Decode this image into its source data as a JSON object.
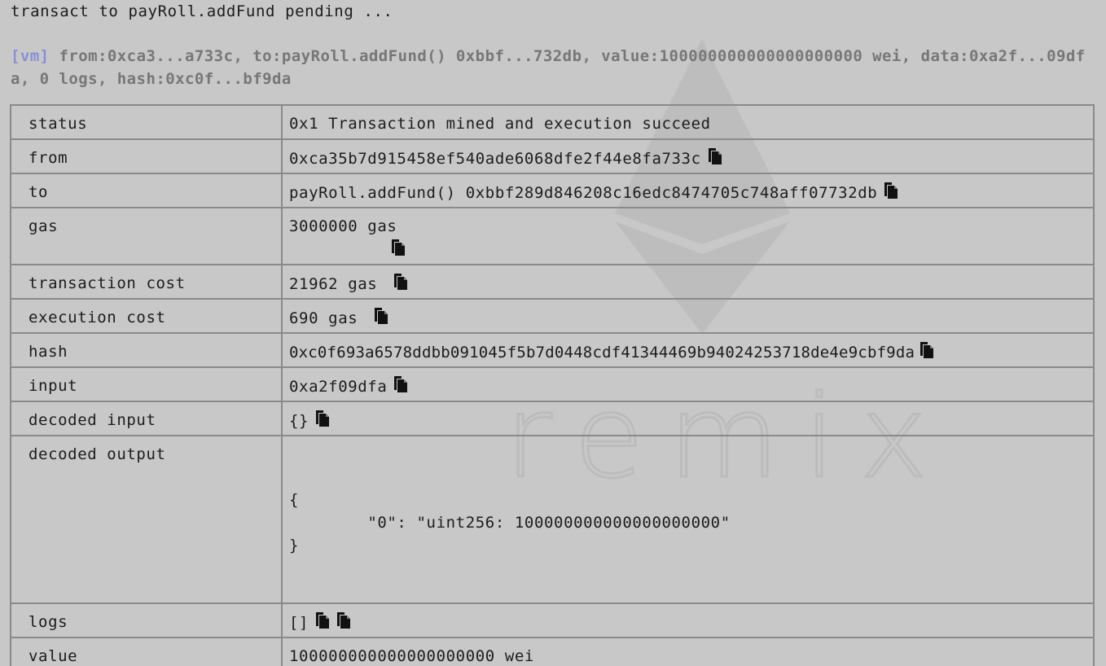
{
  "pending_text": "transact to payRoll.addFund pending ...",
  "summary": {
    "tag": "[vm]",
    "text": " from:0xca3...a733c, to:payRoll.addFund() 0xbbf...732db, value:100000000000000000000 wei, data:0xa2f...09dfa, 0 logs, hash:0xc0f...bf9da"
  },
  "watermark_text": "remix",
  "rows": {
    "status": {
      "label": "status",
      "value": "0x1 Transaction mined and execution succeed"
    },
    "from": {
      "label": "from",
      "value": "0xca35b7d915458ef540ade6068dfe2f44e8fa733c"
    },
    "to": {
      "label": "to",
      "value": "payRoll.addFund() 0xbbf289d846208c16edc8474705c748aff07732db"
    },
    "gas": {
      "label": "gas",
      "value": "3000000 gas"
    },
    "transaction_cost": {
      "label": "transaction cost",
      "value": "21962 gas "
    },
    "execution_cost": {
      "label": "execution cost",
      "value": "690 gas "
    },
    "hash": {
      "label": "hash",
      "value": "0xc0f693a6578ddbb091045f5b7d0448cdf41344469b94024253718de4e9cbf9da"
    },
    "input": {
      "label": "input",
      "value": "0xa2f09dfa"
    },
    "decoded_input": {
      "label": "decoded input",
      "value": "{}"
    },
    "decoded_output": {
      "label": "decoded output",
      "open": "{",
      "line": "\t\"0\": \"uint256: 100000000000000000000\"",
      "close": "}"
    },
    "logs": {
      "label": "logs",
      "value": "[]"
    },
    "value": {
      "label": "value",
      "value": "100000000000000000000 wei"
    }
  },
  "icons": {
    "copy": "copy-to-clipboard-icon"
  }
}
